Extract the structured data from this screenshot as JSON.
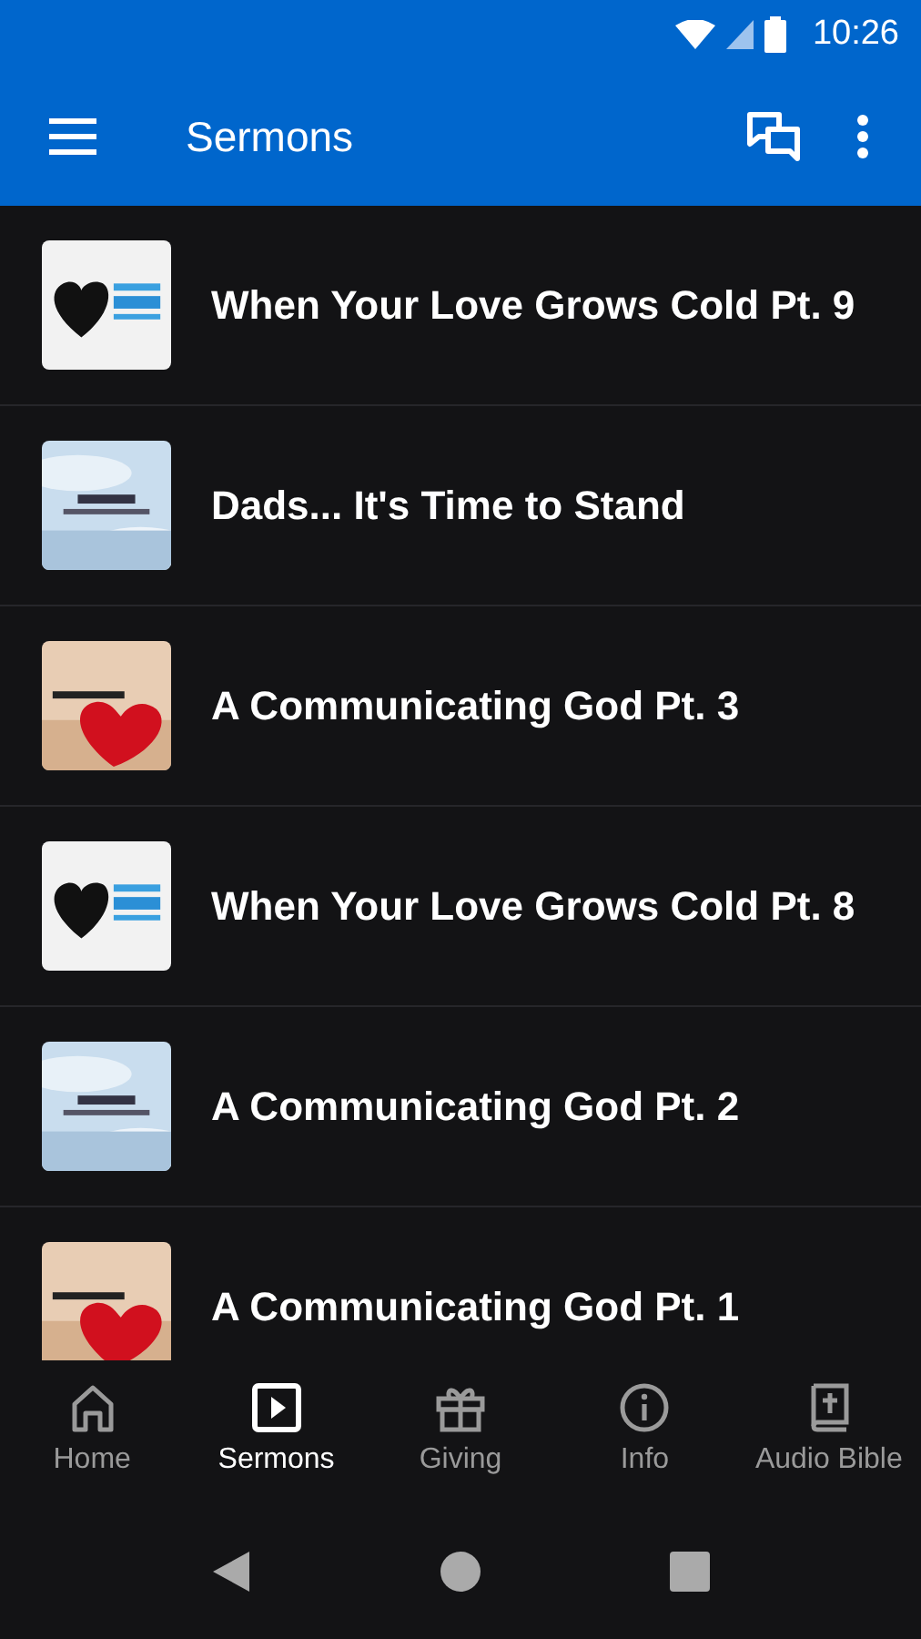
{
  "status_bar": {
    "time": "10:26"
  },
  "app_bar": {
    "title": "Sermons"
  },
  "sermons": [
    {
      "title": "When Your Love Grows Cold Pt. 9",
      "kind": "picture"
    },
    {
      "title": "Dads... It's Time to Stand",
      "kind": "picture"
    },
    {
      "title": "A Communicating God Pt. 3",
      "kind": "picture"
    },
    {
      "title": "When Your Love Grows Cold Pt. 8",
      "kind": "picture"
    },
    {
      "title": "A Communicating God Pt. 2",
      "kind": "picture"
    },
    {
      "title": "A Communicating God Pt. 1",
      "kind": "picture"
    }
  ],
  "bottom_nav": [
    {
      "label": "Home",
      "kind": "home",
      "selected": false
    },
    {
      "label": "Sermons",
      "kind": "sermons",
      "selected": true
    },
    {
      "label": "Giving",
      "kind": "giving",
      "selected": false
    },
    {
      "label": "Info",
      "kind": "info",
      "selected": false
    },
    {
      "label": "Audio Bible",
      "kind": "bible",
      "selected": false
    }
  ]
}
